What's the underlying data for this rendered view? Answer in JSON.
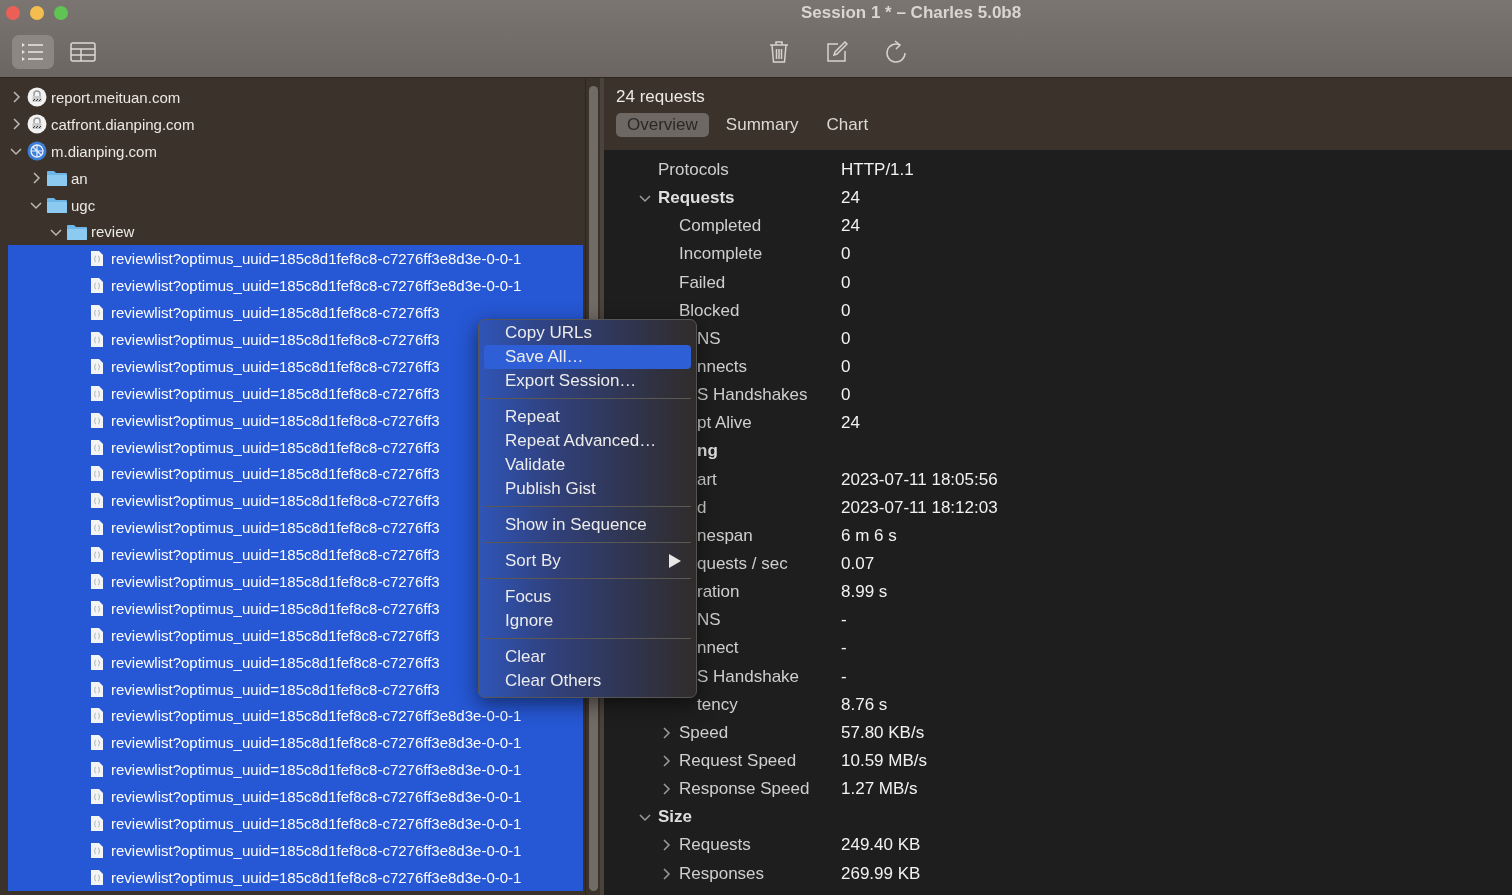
{
  "window": {
    "title": "Session 1 * – Charles 5.0b8"
  },
  "view_toggle": [
    {
      "kind": "list",
      "selected": true
    },
    {
      "kind": "table",
      "selected": false
    }
  ],
  "structure_tree": [
    {
      "kind": "host-locked",
      "label": "report.meituan.com",
      "expanded": false,
      "selected": false
    },
    {
      "kind": "host-locked",
      "label": "catfront.dianping.com",
      "expanded": false,
      "selected": false
    },
    {
      "kind": "host",
      "label": "m.dianping.com",
      "expanded": true,
      "selected": false,
      "children": [
        {
          "kind": "folder",
          "label": "an",
          "expanded": false,
          "selected": false
        },
        {
          "kind": "folder",
          "label": "ugc",
          "expanded": true,
          "selected": false,
          "children": [
            {
              "kind": "folder",
              "label": "review",
              "expanded": true,
              "selected": false,
              "children": [
                {
                  "kind": "file",
                  "label": "reviewlist?optimus_uuid=185c8d1fef8c8-c7276ff3e8d3e-0-0-1",
                  "selected": true
                },
                {
                  "kind": "file",
                  "label": "reviewlist?optimus_uuid=185c8d1fef8c8-c7276ff3e8d3e-0-0-1",
                  "selected": true
                },
                {
                  "kind": "file",
                  "label": "reviewlist?optimus_uuid=185c8d1fef8c8-c7276ff3",
                  "selected": true
                },
                {
                  "kind": "file",
                  "label": "reviewlist?optimus_uuid=185c8d1fef8c8-c7276ff3",
                  "selected": true
                },
                {
                  "kind": "file",
                  "label": "reviewlist?optimus_uuid=185c8d1fef8c8-c7276ff3",
                  "selected": true
                },
                {
                  "kind": "file",
                  "label": "reviewlist?optimus_uuid=185c8d1fef8c8-c7276ff3",
                  "selected": true
                },
                {
                  "kind": "file",
                  "label": "reviewlist?optimus_uuid=185c8d1fef8c8-c7276ff3",
                  "selected": true
                },
                {
                  "kind": "file",
                  "label": "reviewlist?optimus_uuid=185c8d1fef8c8-c7276ff3",
                  "selected": true
                },
                {
                  "kind": "file",
                  "label": "reviewlist?optimus_uuid=185c8d1fef8c8-c7276ff3",
                  "selected": true
                },
                {
                  "kind": "file",
                  "label": "reviewlist?optimus_uuid=185c8d1fef8c8-c7276ff3",
                  "selected": true
                },
                {
                  "kind": "file",
                  "label": "reviewlist?optimus_uuid=185c8d1fef8c8-c7276ff3",
                  "selected": true
                },
                {
                  "kind": "file",
                  "label": "reviewlist?optimus_uuid=185c8d1fef8c8-c7276ff3",
                  "selected": true
                },
                {
                  "kind": "file",
                  "label": "reviewlist?optimus_uuid=185c8d1fef8c8-c7276ff3",
                  "selected": true
                },
                {
                  "kind": "file",
                  "label": "reviewlist?optimus_uuid=185c8d1fef8c8-c7276ff3",
                  "selected": true
                },
                {
                  "kind": "file",
                  "label": "reviewlist?optimus_uuid=185c8d1fef8c8-c7276ff3",
                  "selected": true
                },
                {
                  "kind": "file",
                  "label": "reviewlist?optimus_uuid=185c8d1fef8c8-c7276ff3",
                  "selected": true
                },
                {
                  "kind": "file",
                  "label": "reviewlist?optimus_uuid=185c8d1fef8c8-c7276ff3",
                  "selected": true
                },
                {
                  "kind": "file",
                  "label": "reviewlist?optimus_uuid=185c8d1fef8c8-c7276ff3e8d3e-0-0-1",
                  "selected": true
                },
                {
                  "kind": "file",
                  "label": "reviewlist?optimus_uuid=185c8d1fef8c8-c7276ff3e8d3e-0-0-1",
                  "selected": true
                },
                {
                  "kind": "file",
                  "label": "reviewlist?optimus_uuid=185c8d1fef8c8-c7276ff3e8d3e-0-0-1",
                  "selected": true
                },
                {
                  "kind": "file",
                  "label": "reviewlist?optimus_uuid=185c8d1fef8c8-c7276ff3e8d3e-0-0-1",
                  "selected": true
                },
                {
                  "kind": "file",
                  "label": "reviewlist?optimus_uuid=185c8d1fef8c8-c7276ff3e8d3e-0-0-1",
                  "selected": true
                },
                {
                  "kind": "file",
                  "label": "reviewlist?optimus_uuid=185c8d1fef8c8-c7276ff3e8d3e-0-0-1",
                  "selected": true
                },
                {
                  "kind": "file",
                  "label": "reviewlist?optimus_uuid=185c8d1fef8c8-c7276ff3e8d3e-0-0-1",
                  "selected": true
                }
              ]
            }
          ]
        }
      ]
    }
  ],
  "detail": {
    "heading": "24 requests",
    "tabs": [
      {
        "label": "Overview",
        "selected": true
      },
      {
        "label": "Summary",
        "selected": false
      },
      {
        "label": "Chart",
        "selected": false
      }
    ],
    "stats": [
      {
        "label": "Protocols",
        "value": "HTTP/1.1"
      },
      {
        "label": "Requests",
        "value": "24",
        "expanded": true,
        "children": [
          {
            "label": "Completed",
            "value": "24"
          },
          {
            "label": "Incomplete",
            "value": "0"
          },
          {
            "label": "Failed",
            "value": "0"
          },
          {
            "label": "Blocked",
            "value": "0"
          },
          {
            "label": "NS",
            "value": "0",
            "cut": true
          },
          {
            "label": "nnects",
            "value": "0",
            "cut": true
          },
          {
            "label": "S Handshakes",
            "value": "0",
            "cut": true
          },
          {
            "label": "pt Alive",
            "value": "24",
            "cut": true
          }
        ]
      },
      {
        "label": "ng",
        "cut": true,
        "children": [
          {
            "label": "art",
            "value": "2023-07-11 18:05:56",
            "cut": true
          },
          {
            "label": "d",
            "value": "2023-07-11 18:12:03",
            "cut": true
          },
          {
            "label": "nespan",
            "value": "6 m 6 s",
            "cut": true
          },
          {
            "label": "quests / sec",
            "value": "0.07",
            "cut": true
          },
          {
            "label": "ration",
            "value": "8.99 s",
            "cut": true
          },
          {
            "label": "NS",
            "value": "-",
            "cut": true
          },
          {
            "label": "nnect",
            "value": "-",
            "cut": true
          },
          {
            "label": "S Handshake",
            "value": "-",
            "cut": true
          },
          {
            "label": "tency",
            "value": "8.76 s",
            "cut": true
          },
          {
            "label": "Speed",
            "value": "57.80 KB/s",
            "expanded": false
          },
          {
            "label": "Request Speed",
            "value": "10.59 MB/s",
            "expanded": false
          },
          {
            "label": "Response Speed",
            "value": "1.27 MB/s",
            "expanded": false
          }
        ]
      },
      {
        "label": "Size",
        "expanded": true,
        "children": [
          {
            "label": "Requests",
            "value": "249.40 KB",
            "expanded": false
          },
          {
            "label": "Responses",
            "value": "269.99 KB",
            "expanded": false
          }
        ]
      }
    ]
  },
  "context_menu": {
    "items": [
      {
        "kind": "item",
        "label": "Copy URLs",
        "selected": false
      },
      {
        "kind": "item",
        "label": "Save All…",
        "selected": true
      },
      {
        "kind": "item",
        "label": "Export Session…",
        "selected": false
      },
      {
        "kind": "separator"
      },
      {
        "kind": "item",
        "label": "Repeat",
        "selected": false
      },
      {
        "kind": "item",
        "label": "Repeat Advanced…",
        "selected": false
      },
      {
        "kind": "item",
        "label": "Validate",
        "selected": false
      },
      {
        "kind": "item",
        "label": "Publish Gist",
        "selected": false
      },
      {
        "kind": "separator"
      },
      {
        "kind": "item",
        "label": "Show in Sequence",
        "selected": false
      },
      {
        "kind": "separator"
      },
      {
        "kind": "item",
        "label": "Sort By",
        "selected": false,
        "submenu": true
      },
      {
        "kind": "separator"
      },
      {
        "kind": "item",
        "label": "Focus",
        "selected": false
      },
      {
        "kind": "item",
        "label": "Ignore",
        "selected": false
      },
      {
        "kind": "separator"
      },
      {
        "kind": "item",
        "label": "Clear",
        "selected": false
      },
      {
        "kind": "item",
        "label": "Clear Others",
        "selected": false
      }
    ]
  }
}
